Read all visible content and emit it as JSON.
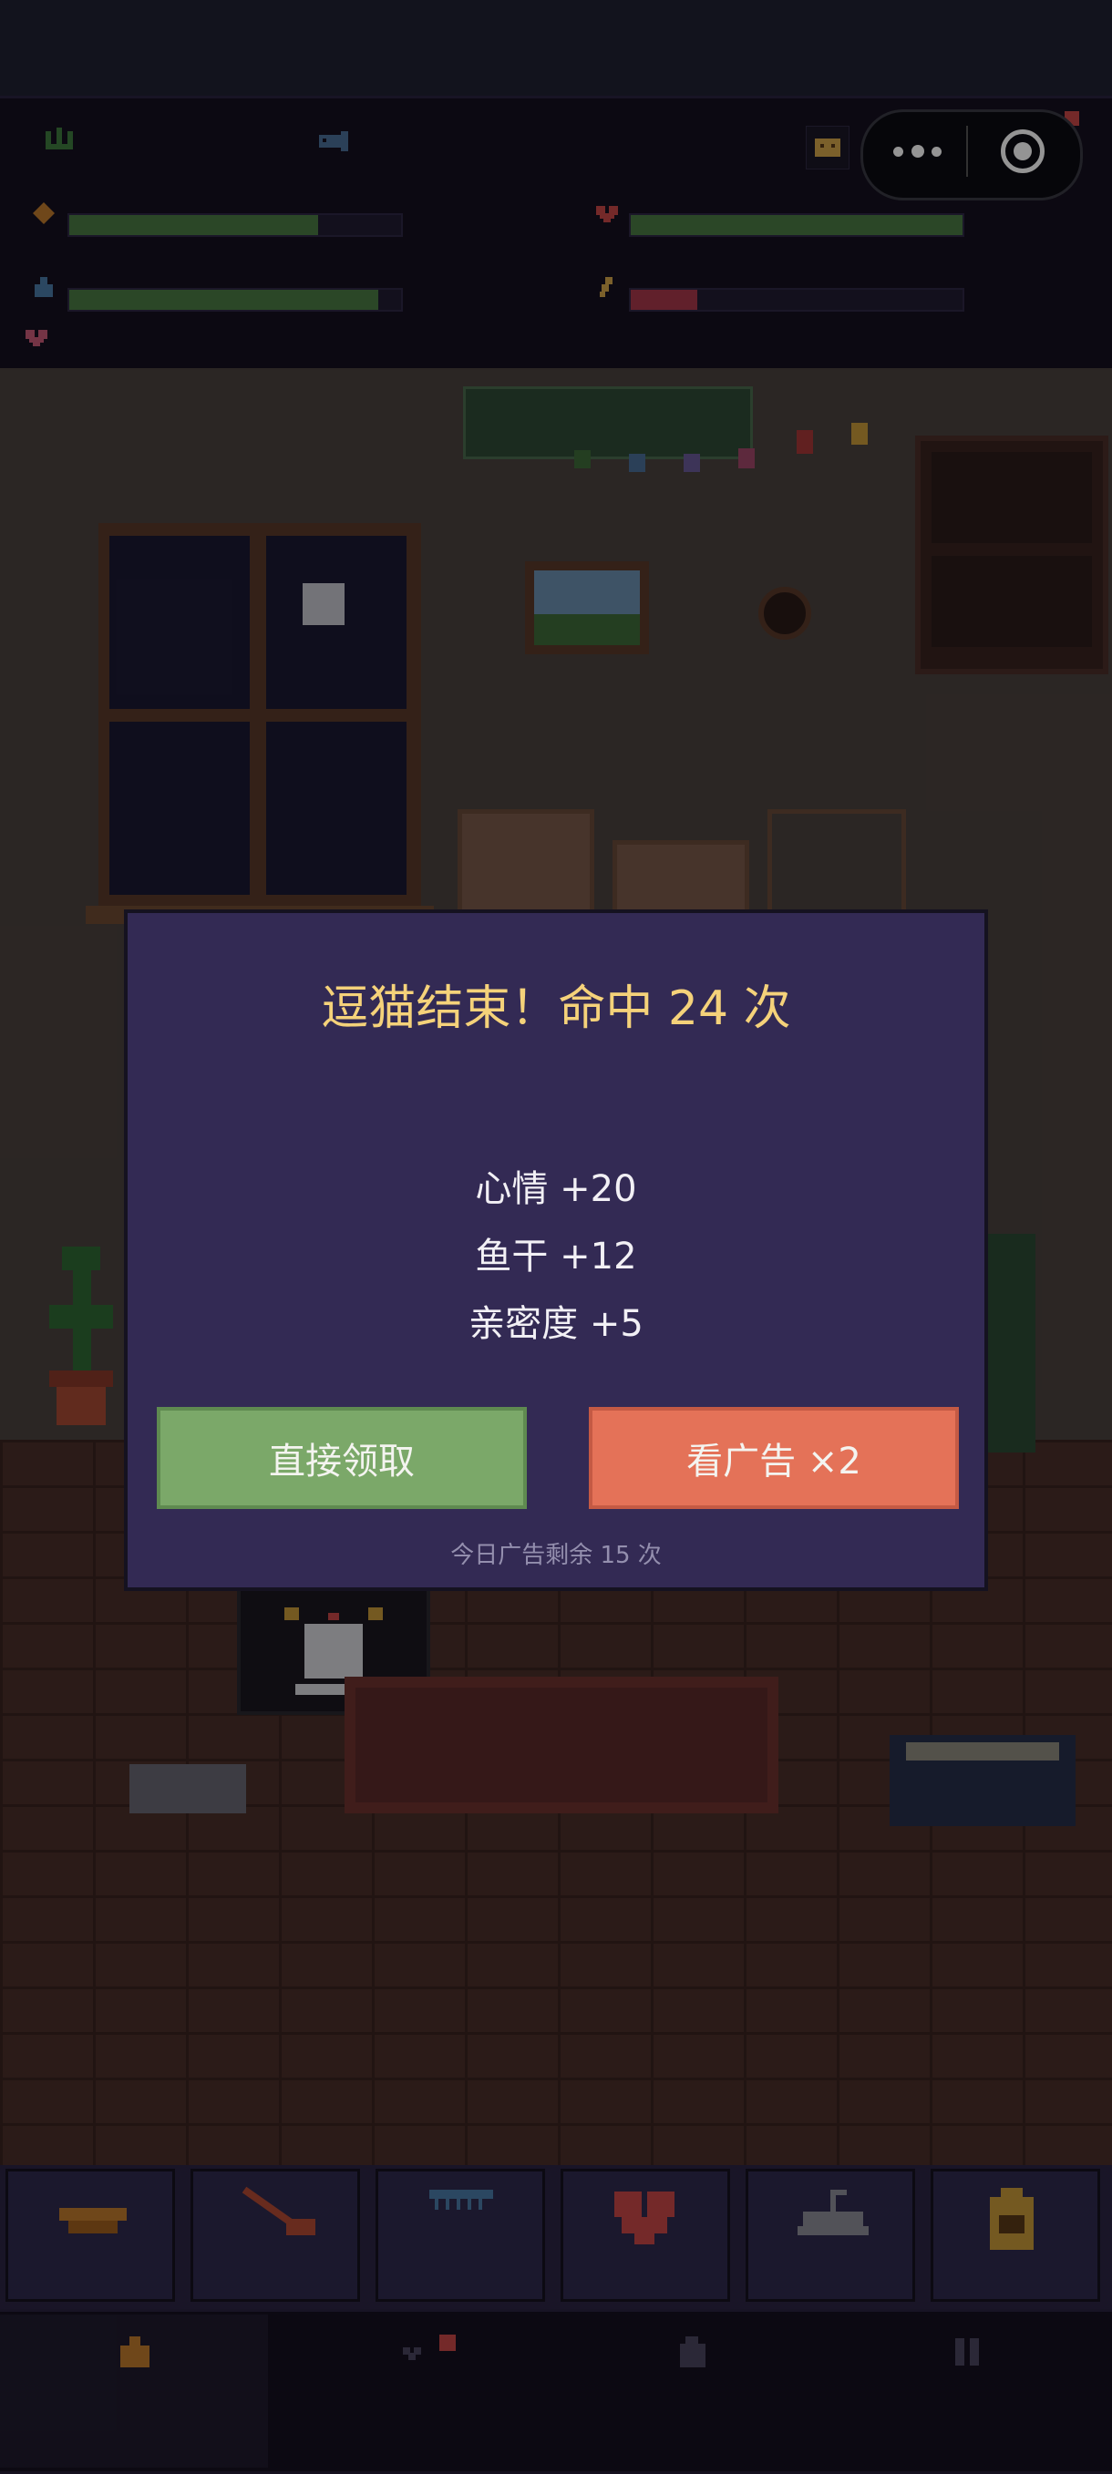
{
  "dialog": {
    "title": "逗猫结束！命中 24 次",
    "rewards": [
      "心情 +20",
      "鱼干 +12",
      "亲密度 +5"
    ],
    "claim_label": "直接领取",
    "ad_label": "看广告 ×2",
    "ad_note": "今日广告剩余 15 次"
  },
  "stats": {
    "left": [
      {
        "icon": "food-icon",
        "color": "#4b7a44",
        "value": 0.75
      },
      {
        "icon": "water-icon",
        "color": "#4b7a44",
        "value": 0.93
      }
    ],
    "right": [
      {
        "icon": "heart-icon",
        "color": "#4b7a44",
        "value": 1.0
      },
      {
        "icon": "energy-icon",
        "color": "#a8384a",
        "value": 0.2
      }
    ]
  },
  "action_bar": [
    "feed-bowl-icon",
    "fishing-rod-icon",
    "comb-icon",
    "heart-icon",
    "litter-icon",
    "bag-icon"
  ],
  "nav": [
    "home-icon",
    "stats-icon",
    "shop-icon",
    "pause-icon"
  ]
}
